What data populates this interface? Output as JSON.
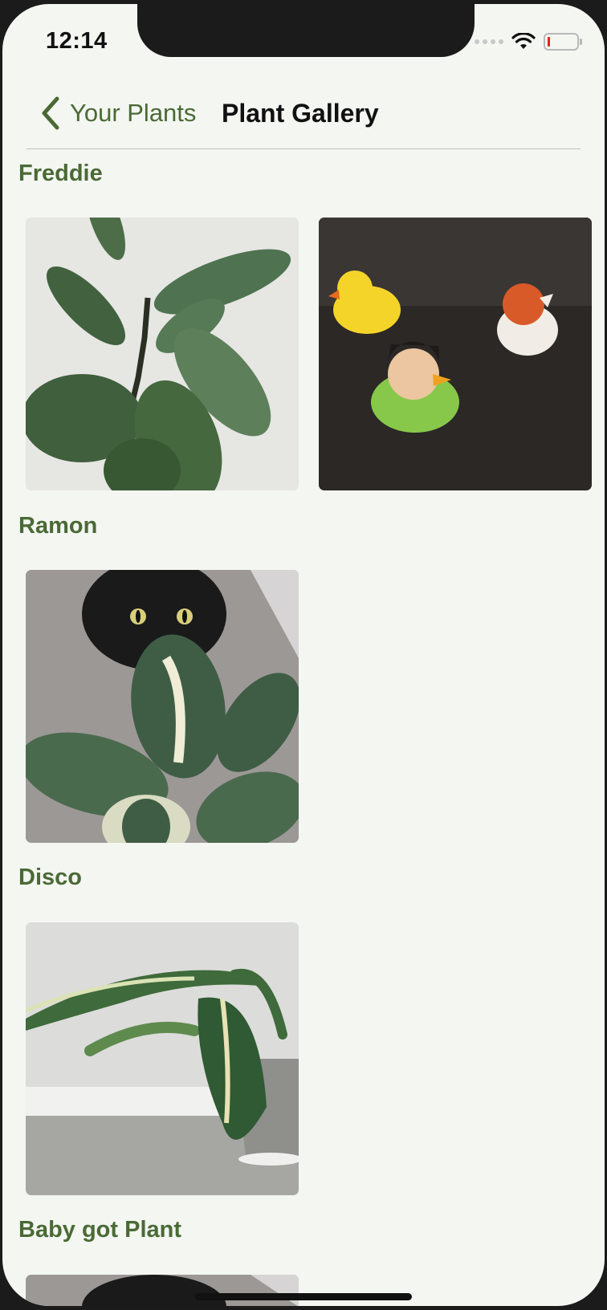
{
  "status_bar": {
    "time": "12:14"
  },
  "nav": {
    "back_label": "Your Plants",
    "title": "Plant Gallery"
  },
  "sections": [
    {
      "name": "Freddie"
    },
    {
      "name": "Ramon"
    },
    {
      "name": "Disco"
    },
    {
      "name": "Baby got Plant"
    }
  ],
  "colors": {
    "accent": "#4a6a35",
    "background": "#f4f6f2"
  }
}
